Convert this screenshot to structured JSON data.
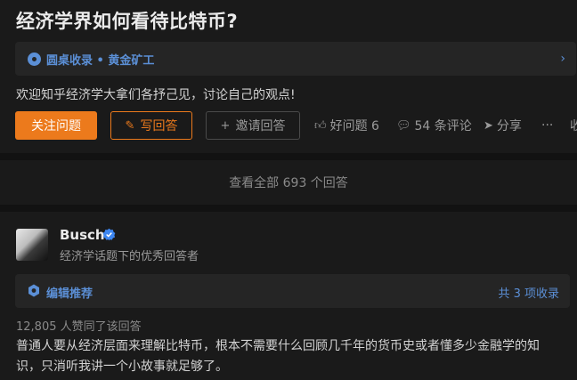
{
  "question": {
    "title": "经济学界如何看待比特币?",
    "roundtable": "圆桌收录 • 黄金矿工",
    "detail": "欢迎知乎经济学大拿们各抒己见，讨论自己的观点!",
    "actions": {
      "follow_label": "关注问题",
      "write_label": "写回答",
      "invite_label": "邀请回答",
      "good_question_label": "好问题 6",
      "comments_label": "54 条评论",
      "share_label": "分享",
      "more_label": "···",
      "cut_label": "收"
    }
  },
  "view_all": "查看全部 693 个回答",
  "answer": {
    "author": {
      "name": "Busch",
      "bio": "经济学话题下的优秀回答者"
    },
    "recommend": {
      "label": "编辑推荐",
      "count": "共 3 项收录"
    },
    "votes": "12,805 人赞同了该回答",
    "content": "普通人要从经济层面来理解比特币，根本不需要什么回顾几千年的货币史或者懂多少金融学的知识，只消听我讲一个小故事就足够了。"
  },
  "colors": {
    "accent_orange": "#ec7a1c",
    "link_blue": "#5b8fd6",
    "card_bg": "#1a1a1a",
    "page_bg": "#121212"
  }
}
